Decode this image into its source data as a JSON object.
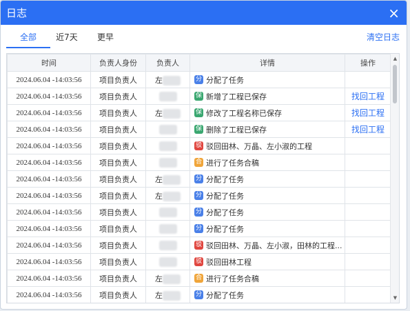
{
  "dialog": {
    "title": "日志",
    "close_glyph": "×"
  },
  "tabs": [
    {
      "label": "全部",
      "active": true
    },
    {
      "label": "近7天",
      "active": false
    },
    {
      "label": "更早",
      "active": false
    }
  ],
  "clear_label": "清空日志",
  "columns": [
    "时间",
    "负责人身份",
    "负责人",
    "详情",
    "操作"
  ],
  "colors": {
    "accent": "#2b6ff3",
    "assign": "#4a80e8",
    "save": "#3aa770",
    "reject": "#e0463f",
    "merge": "#f0a53a"
  },
  "rows": [
    {
      "time": "2024.06.04 -14:03:56",
      "role": "项目负责人",
      "person": "左",
      "badge": "分",
      "badge_type": "assign",
      "detail": "分配了任务",
      "action": ""
    },
    {
      "time": "2024.06.04 -14:03:56",
      "role": "项目负责人",
      "person": "",
      "badge": "保",
      "badge_type": "save",
      "detail": "新增了工程已保存",
      "action": "找回工程"
    },
    {
      "time": "2024.06.04 -14:03:56",
      "role": "项目负责人",
      "person": "左",
      "badge": "保",
      "badge_type": "save",
      "detail": "修改了工程名称已保存",
      "action": "找回工程"
    },
    {
      "time": "2024.06.04 -14:03:56",
      "role": "项目负责人",
      "person": "",
      "badge": "保",
      "badge_type": "save",
      "detail": "删除了工程已保存",
      "action": "找回工程"
    },
    {
      "time": "2024.06.04 -14:03:56",
      "role": "项目负责人",
      "person": "",
      "badge": "驳",
      "badge_type": "reject",
      "detail": "驳回田林、万晶、左小淑的工程",
      "action": ""
    },
    {
      "time": "2024.06.04 -14:03:56",
      "role": "项目负责人",
      "person": "",
      "badge": "合",
      "badge_type": "merge",
      "detail": "进行了任务合稿",
      "action": ""
    },
    {
      "time": "2024.06.04 -14:03:56",
      "role": "项目负责人",
      "person": "左",
      "badge": "分",
      "badge_type": "assign",
      "detail": "分配了任务",
      "action": ""
    },
    {
      "time": "2024.06.04 -14:03:56",
      "role": "项目负责人",
      "person": "左",
      "badge": "分",
      "badge_type": "assign",
      "detail": "分配了任务",
      "action": ""
    },
    {
      "time": "2024.06.04 -14:03:56",
      "role": "项目负责人",
      "person": "",
      "badge": "分",
      "badge_type": "assign",
      "detail": "分配了任务",
      "action": ""
    },
    {
      "time": "2024.06.04 -14:03:56",
      "role": "项目负责人",
      "person": "",
      "badge": "分",
      "badge_type": "assign",
      "detail": "分配了任务",
      "action": ""
    },
    {
      "time": "2024.06.04 -14:03:56",
      "role": "项目负责人",
      "person": "",
      "badge": "驳",
      "badge_type": "reject",
      "detail": "驳回田林、万晶、左小淑，田林的工程...",
      "action": ""
    },
    {
      "time": "2024.06.04 -14:03:56",
      "role": "项目负责人",
      "person": "",
      "badge": "驳",
      "badge_type": "reject",
      "detail": "驳回田林工程",
      "action": ""
    },
    {
      "time": "2024.06.04 -14:03:56",
      "role": "项目负责人",
      "person": "左",
      "badge": "合",
      "badge_type": "merge",
      "detail": "进行了任务合稿",
      "action": ""
    },
    {
      "time": "2024.06.04 -14:03:56",
      "role": "项目负责人",
      "person": "左",
      "badge": "分",
      "badge_type": "assign",
      "detail": "分配了任务",
      "action": ""
    }
  ]
}
